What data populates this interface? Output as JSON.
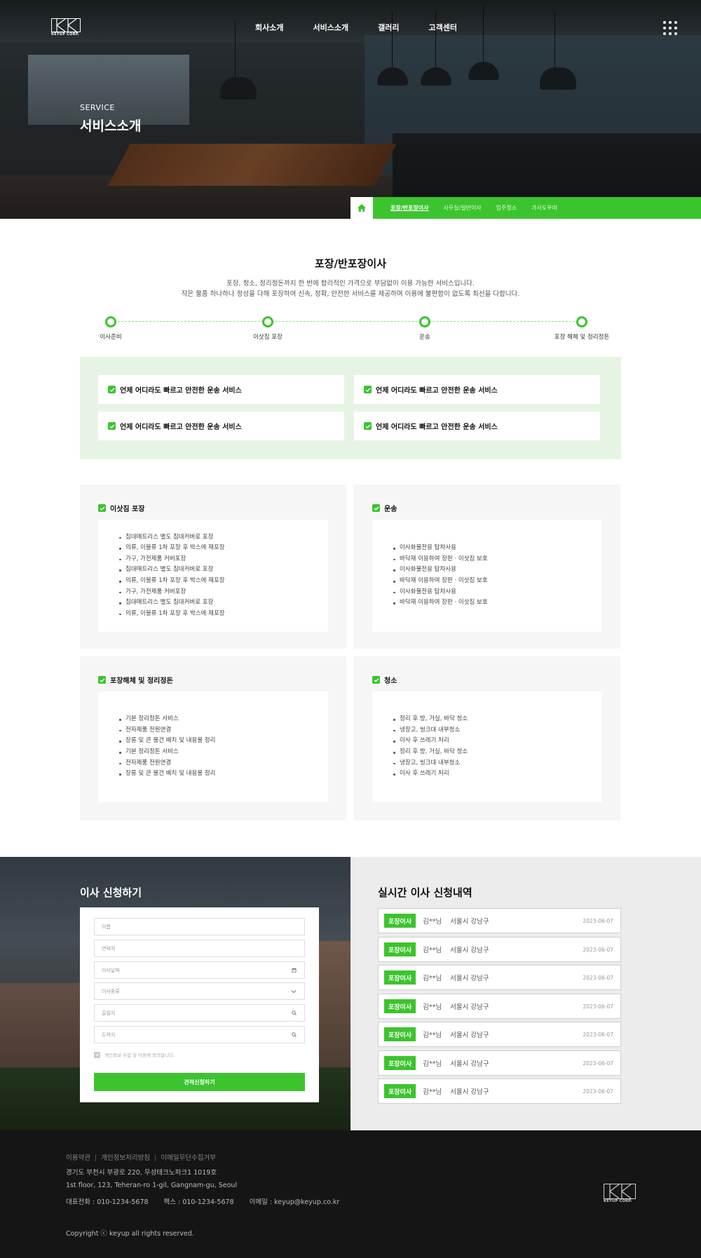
{
  "brand": {
    "logo_text": "KEYUP CORP."
  },
  "nav": {
    "items": [
      "회사소개",
      "서비스소개",
      "갤러리",
      "고객센터"
    ]
  },
  "hero": {
    "subtitle": "SERVICE",
    "title": "서비스소개"
  },
  "subnav": {
    "items": [
      "포장/반포장이사",
      "사무실/일반이사",
      "입주청소",
      "가사도우미"
    ],
    "active": 0
  },
  "section": {
    "title": "포장/반포장이사",
    "desc_line1": "포장, 청소, 정리정돈까지 한 번에 합리적인 가격으로 부담없이 이용 가능한 서비스입니다.",
    "desc_line2": "작은 물품 하나하나 정성을 다해 포장하여 신속, 정확, 안전한 서비스를 제공하며 이용에 불편함이 없도록 최선을 다합니다."
  },
  "process": {
    "steps": [
      "이사준비",
      "이삿짐 포장",
      "운송",
      "포장 해체 및 정리정돈"
    ]
  },
  "features": [
    "언제 어디라도 빠르고 안전한 운송 서비스",
    "언제 어디라도 빠르고 안전한 운송 서비스",
    "언제 어디라도 빠르고 안전한 운송 서비스",
    "언제 어디라도 빠르고 안전한 운송 서비스"
  ],
  "cards": [
    {
      "title": "이삿짐 포장",
      "items": [
        "침대매트리스 별도 침대커버로 포장",
        "의류, 이불류 1차 포장 후 박스에 재포장",
        "가구, 가전제품 커버포장",
        "침대매트리스 별도 침대커버로 포장",
        "의류, 이불류 1차 포장 후 박스에 재포장",
        "가구, 가전제품 커버포장",
        "침대매트리스 별도 침대커버로 포장",
        "의류, 이불류 1차 포장 후 박스에 재포장"
      ]
    },
    {
      "title": "운송",
      "items": [
        "이사화물전용 탑차사용",
        "바닥재 이용하여 장판 · 이삿짐 보호",
        "이사화물전용 탑차사용",
        "바닥재 이용하여 장판 · 이삿짐 보호",
        "이사화물전용 탑차사용",
        "바닥재 이용하여 장판 · 이삿짐 보호"
      ]
    },
    {
      "title": "포장해체 및 정리정돈",
      "items": [
        "기본 정리정돈 서비스",
        "전자제품 전원연결",
        "장롱 및 큰 물건 배치 및 내용물 정리",
        "기본 정리정돈 서비스",
        "전자제품 전원연결",
        "장롱 및 큰 물건 배치 및 내용물 정리"
      ]
    },
    {
      "title": "청소",
      "items": [
        "정리 후 방, 거실, 바닥 청소",
        "냉장고, 씽크대 내부청소",
        "이사 후 쓰레기 처리",
        "정리 후 방, 거실, 바닥 청소",
        "냉장고, 씽크대 내부청소",
        "이사 후 쓰레기 처리"
      ]
    }
  ],
  "apply": {
    "title": "이사 신청하기",
    "fields": [
      {
        "placeholder": "이름",
        "icon": ""
      },
      {
        "placeholder": "연락처",
        "icon": ""
      },
      {
        "placeholder": "이사날짜",
        "icon": "calendar-icon"
      },
      {
        "placeholder": "이사종류",
        "icon": "chevron-down-icon"
      },
      {
        "placeholder": "출발지",
        "icon": "search-icon"
      },
      {
        "placeholder": "도착지",
        "icon": "search-icon"
      }
    ],
    "agree_label": "개인정보 수집 및 이용에 동의합니다.",
    "submit_label": "견적신청하기"
  },
  "live": {
    "title": "실시간 이사 신청내역",
    "rows": [
      {
        "badge": "포장이사",
        "name": "김**님",
        "area": "서울시 강남구",
        "date": "2023-06-07"
      },
      {
        "badge": "포장이사",
        "name": "김**님",
        "area": "서울시 강남구",
        "date": "2023-06-07"
      },
      {
        "badge": "포장이사",
        "name": "김**님",
        "area": "서울시 강남구",
        "date": "2023-06-07"
      },
      {
        "badge": "포장이사",
        "name": "김**님",
        "area": "서울시 강남구",
        "date": "2023-06-07"
      },
      {
        "badge": "포장이사",
        "name": "김**님",
        "area": "서울시 강남구",
        "date": "2023-06-07"
      },
      {
        "badge": "포장이사",
        "name": "김**님",
        "area": "서울시 강남구",
        "date": "2023-06-07"
      },
      {
        "badge": "포장이사",
        "name": "김**님",
        "area": "서울시 강남구",
        "date": "2023-06-07"
      }
    ]
  },
  "footer": {
    "links": [
      "이용약관",
      "개인정보처리방침",
      "이메일무단수집거부"
    ],
    "address_ko": "경기도 부천시 부광로 220, 우성테크노파크1 1019호",
    "address_en": "1st floor, 123, Teheran-ro 1-gil, Gangnam-gu, Seoul",
    "phone": "대표전화 : 010-1234-5678",
    "fax": "팩스 : 010-1234-5678",
    "email": "이메일 : keyup@keyup.co.kr",
    "copyright": "Copyright ⓒ keyup all rights reserved."
  },
  "colors": {
    "accent": "#3cc42e",
    "feature_bg": "#e6f5e3",
    "footer_bg": "#151515"
  }
}
